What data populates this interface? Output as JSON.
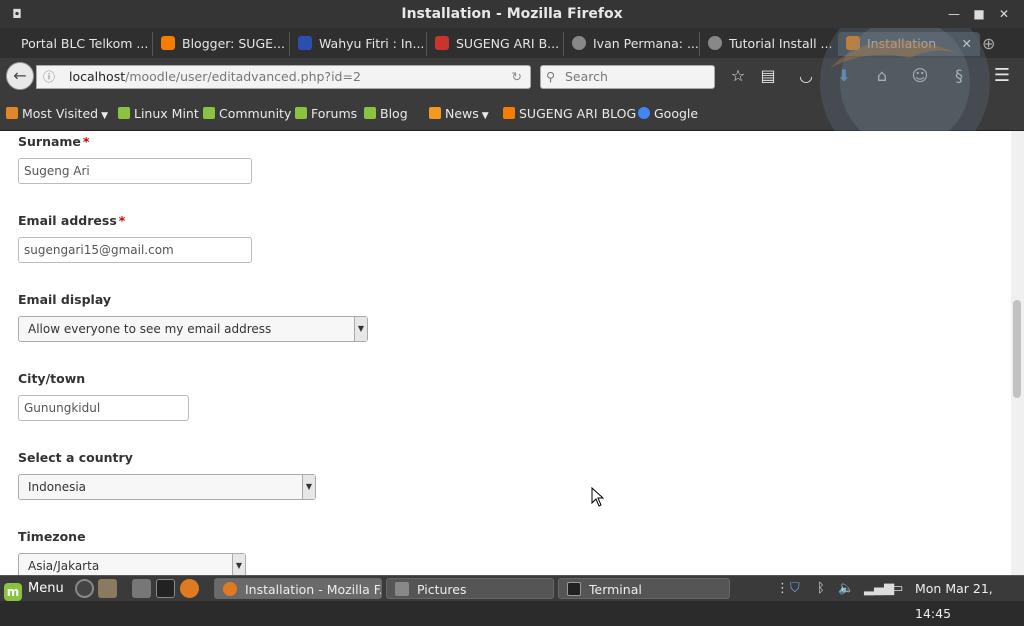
{
  "window": {
    "title": "Installation - Mozilla Firefox"
  },
  "tabs": [
    {
      "label": "Portal BLC Telkom ..."
    },
    {
      "label": "Blogger: SUGE..."
    },
    {
      "label": "Wahyu Fitri : In..."
    },
    {
      "label": "SUGENG ARI B..."
    },
    {
      "label": "Ivan Permana: ..."
    },
    {
      "label": "Tutorial Install ..."
    },
    {
      "label": "Installation"
    }
  ],
  "urlbar": {
    "host": "localhost",
    "path": "/moodle/user/editadvanced.php?id=2"
  },
  "search": {
    "placeholder": "Search"
  },
  "bookmarks": [
    {
      "label": "Most Visited"
    },
    {
      "label": "Linux Mint"
    },
    {
      "label": "Community"
    },
    {
      "label": "Forums"
    },
    {
      "label": "Blog"
    },
    {
      "label": "News"
    },
    {
      "label": "SUGENG ARI BLOG"
    },
    {
      "label": "Google"
    }
  ],
  "form": {
    "surname": {
      "label": "Surname",
      "required": "*",
      "value": "Sugeng Ari"
    },
    "email": {
      "label": "Email address",
      "required": "*",
      "value": "sugengari15@gmail.com"
    },
    "email_display": {
      "label": "Email display",
      "value": "Allow everyone to see my email address"
    },
    "city": {
      "label": "City/town",
      "value": "Gunungkidul"
    },
    "country": {
      "label": "Select a country",
      "value": "Indonesia"
    },
    "timezone": {
      "label": "Timezone",
      "value": "Asia/Jakarta"
    }
  },
  "taskbar": {
    "menu_label": "Menu",
    "windows": [
      {
        "label": "Installation - Mozilla F..."
      },
      {
        "label": "Pictures"
      },
      {
        "label": "Terminal"
      }
    ],
    "clock": "Mon Mar 21, 14:45"
  },
  "colors": {
    "required": "#cc0000",
    "mint": "#8ac340",
    "active_tab": "#4c5257"
  }
}
